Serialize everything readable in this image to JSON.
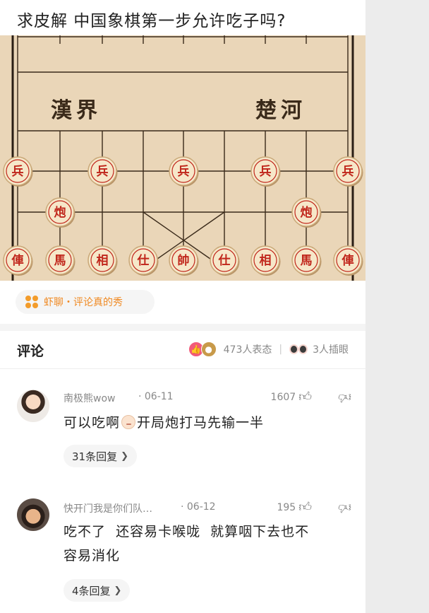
{
  "post": {
    "title": "求皮解 中国象棋第一步允许吃子吗?",
    "board": {
      "river_left": "漢界",
      "river_right": "楚河",
      "pawns": [
        "兵",
        "兵",
        "兵",
        "兵",
        "兵"
      ],
      "cannons": [
        "炮",
        "炮"
      ],
      "back_row": [
        "俥",
        "馬",
        "相",
        "仕",
        "帥",
        "仕",
        "相",
        "馬",
        "俥"
      ],
      "piece_color": "#c0261b",
      "board_color": "#ead6b8"
    },
    "tag_label": "虾聊・评论真的秀"
  },
  "comments_header": {
    "title": "评论",
    "reactions_text": "473人表态",
    "separator": "|",
    "views_text": "3人插眼"
  },
  "comments": [
    {
      "name": "南极熊wow",
      "date": "· 06-11",
      "likes": "1607",
      "text_before": "可以吃啊",
      "text_after": "开局炮打马先输一半",
      "reply_label": "31条回复"
    },
    {
      "name": "快开门我是你们队…",
      "date": "· 06-12",
      "likes": "195",
      "text_line1": "吃不了  还容易卡喉咙  就算咽下去也不",
      "text_line2": "容易消化",
      "reply_label": "4条回复"
    }
  ],
  "icons": {
    "like": "thumbs-up-icon",
    "dislike": "thumbs-down-icon",
    "chevron": "chevron-right-icon",
    "accent": "#f08a24"
  }
}
